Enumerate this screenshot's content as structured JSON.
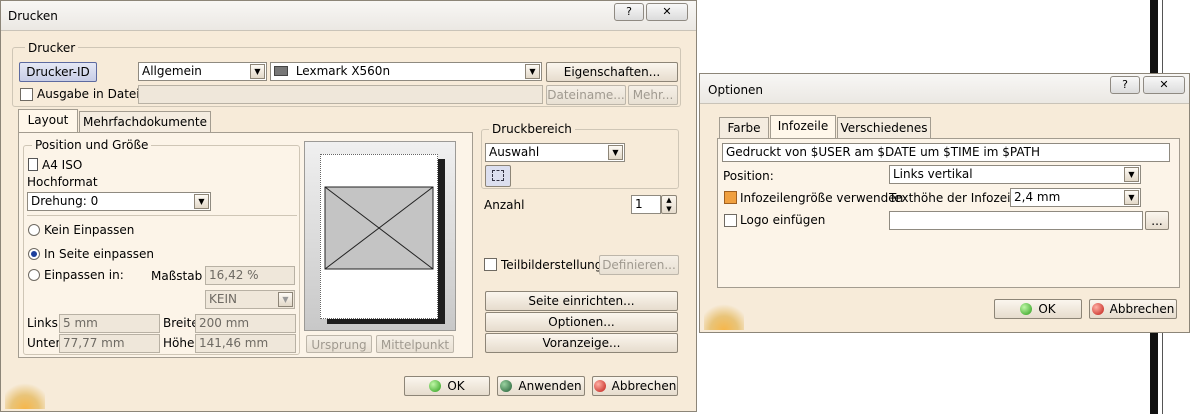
{
  "colors": {
    "dialog_bg": "#f7ebd9",
    "border": "#8c8578",
    "field_bg": "#ffffff",
    "title_bar": "#f4f2ef"
  },
  "print": {
    "title": "Drucken",
    "help_label": "?",
    "close_label": "✕",
    "printer_group": "Drucker",
    "printer_id_btn": "Drucker-ID",
    "printer_type": "Allgemein",
    "printer_name": "Lexmark X560n",
    "properties_btn": "Eigenschaften...",
    "output_to_file": "Ausgabe in Datei:",
    "filename_btn": "Dateiname...",
    "more_btn": "Mehr...",
    "tabs": [
      "Layout",
      "Mehrfachdokumente"
    ],
    "position_group": "Position und Größe",
    "paper_size": "A4 ISO",
    "orientation": "Hochformat",
    "rotation": "Drehung: 0",
    "fit_none": "Kein Einpassen",
    "fit_page": "In Seite einpassen",
    "fit_in": "Einpassen in:",
    "scale_label": "Maßstab",
    "scale_value": "16,42 %",
    "unit_value": "KEIN",
    "left_label": "Links",
    "left_value": "5 mm",
    "width_label": "Breite",
    "width_value": "200 mm",
    "bottom_label": "Unten",
    "bottom_value": "77,77 mm",
    "height_label": "Höhe",
    "height_value": "141,46 mm",
    "origin_btn": "Ursprung",
    "center_btn": "Mittelpunkt",
    "print_area_group": "Druckbereich",
    "print_area_value": "Auswahl",
    "copies_label": "Anzahl",
    "copies_value": "1",
    "tile_label": "Teilbilderstellung",
    "define_btn": "Definieren...",
    "page_setup_btn": "Seite einrichten...",
    "options_btn": "Optionen...",
    "preview_btn": "Voranzeige...",
    "ok_btn": "OK",
    "apply_btn": "Anwenden",
    "cancel_btn": "Abbrechen"
  },
  "options": {
    "title": "Optionen",
    "help_label": "?",
    "close_label": "✕",
    "tabs": [
      "Farbe",
      "Infozeile",
      "Verschiedenes"
    ],
    "info_text": "Gedruckt von $USER am $DATE um $TIME im $PATH",
    "position_label": "Position:",
    "position_value": "Links vertikal",
    "use_size_label": "Infozeilengröße verwenden",
    "text_height_label": "Texthöhe der Infozeile:",
    "text_height_value": "2,4 mm",
    "logo_label": "Logo einfügen",
    "browse_btn": "...",
    "ok_btn": "OK",
    "cancel_btn": "Abbrechen"
  }
}
